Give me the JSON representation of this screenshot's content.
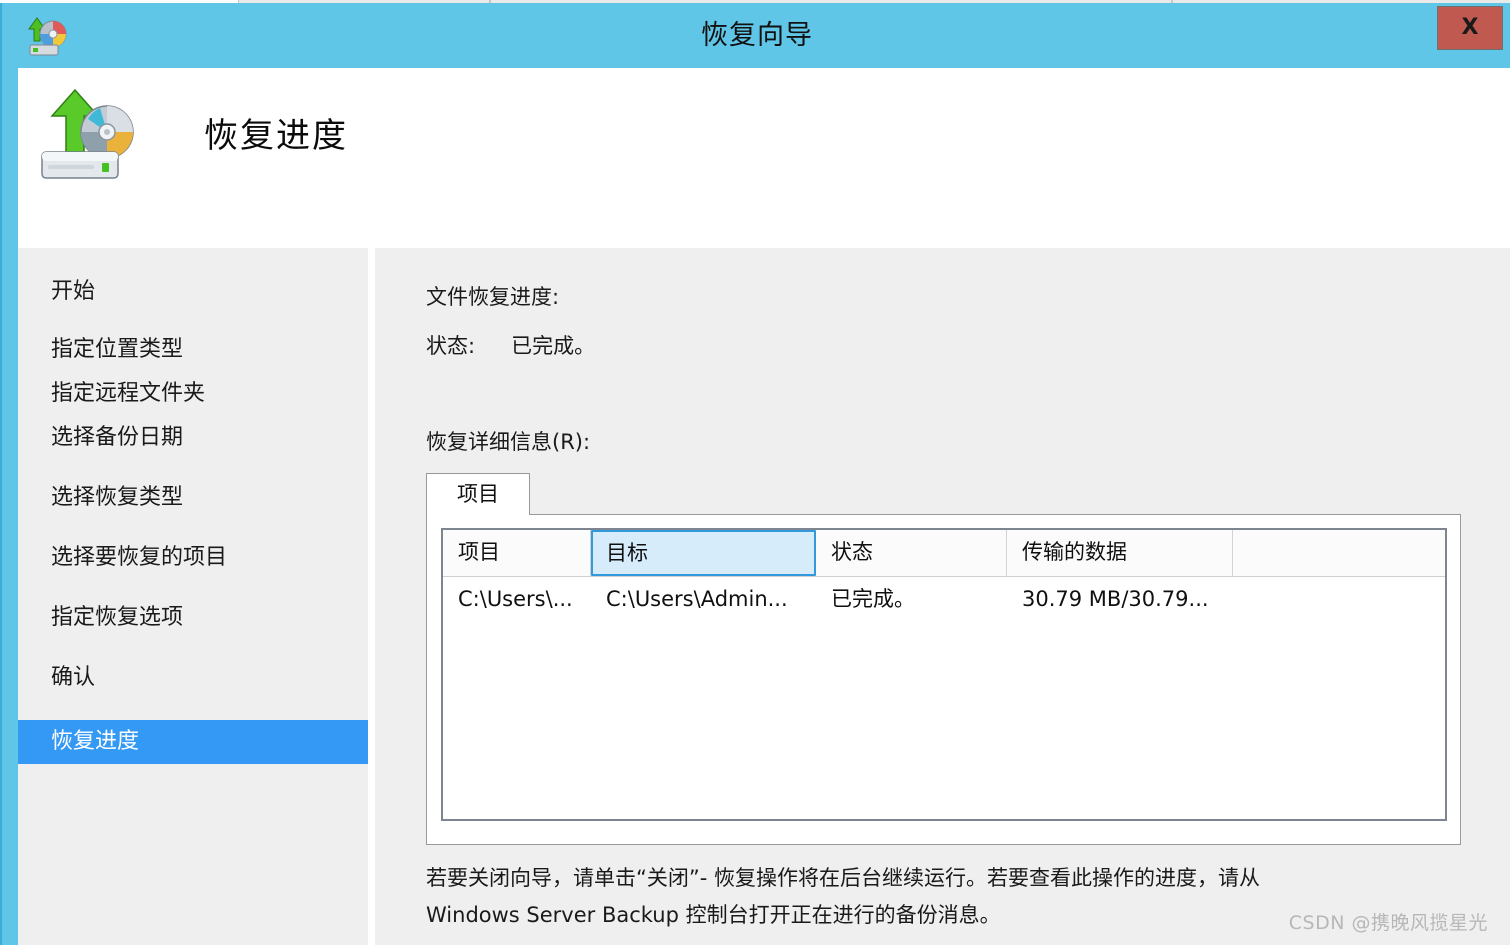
{
  "window": {
    "title": "恢复向导",
    "close_label": "X",
    "title_icon": "restore-disc-icon",
    "accent_color": "#5fc6e8",
    "close_color": "#c05a51"
  },
  "header": {
    "title": "恢复进度",
    "icon": "restore-drive-icon"
  },
  "sidebar": {
    "items": [
      {
        "label": "开始",
        "active": false
      },
      {
        "label": "指定位置类型",
        "active": false
      },
      {
        "label": "指定远程文件夹",
        "active": false
      },
      {
        "label": "选择备份日期",
        "active": false
      },
      {
        "label": "选择恢复类型",
        "active": false
      },
      {
        "label": "选择要恢复的项目",
        "active": false
      },
      {
        "label": "指定恢复选项",
        "active": false
      },
      {
        "label": "确认",
        "active": false
      },
      {
        "label": "恢复进度",
        "active": true
      }
    ],
    "active_color": "#3399f5"
  },
  "main": {
    "progress_label": "文件恢复进度:",
    "status_key": "状态:",
    "status_value": "已完成。",
    "details_label": "恢复详细信息(R):",
    "tabs": [
      {
        "label": "项目",
        "selected": true
      }
    ],
    "table": {
      "columns": [
        "项目",
        "目标",
        "状态",
        "传输的数据",
        ""
      ],
      "highlighted_column": "目标",
      "rows": [
        {
          "item": "C:\\Users\\...",
          "target": "C:\\Users\\Admin...",
          "status": "已完成。",
          "transferred": "30.79 MB/30.79..."
        }
      ]
    },
    "footer_note_line1": "若要关闭向导，请单击“关闭”- 恢复操作将在后台继续运行。若要查看此操作的进度，请从",
    "footer_note_line2": "Windows Server Backup 控制台打开正在进行的备份消息。"
  },
  "watermark": {
    "text": "CSDN @携晚风揽星光"
  }
}
